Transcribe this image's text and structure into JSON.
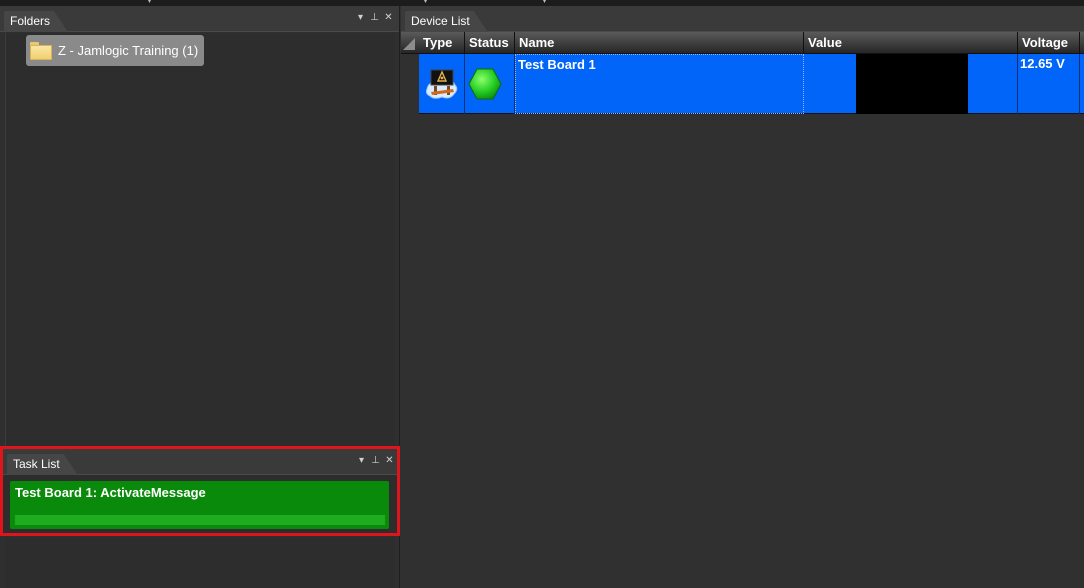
{
  "folders_panel": {
    "title": "Folders",
    "items": [
      {
        "label": "Z - Jamlogic Training (1)"
      }
    ]
  },
  "task_panel": {
    "title": "Task List",
    "tasks": [
      {
        "title": "Test Board 1: ActivateMessage",
        "progress": 1.0
      }
    ]
  },
  "device_panel": {
    "title": "Device List",
    "columns": [
      "Type",
      "Status",
      "Name",
      "Value",
      "Voltage"
    ],
    "rows": [
      {
        "type_icon": "sign-board-icon",
        "status_icon": "green-hexagon-icon",
        "name": "Test Board 1",
        "value": "",
        "voltage": "12.65 V"
      }
    ]
  },
  "pane_controls": {
    "dropdown": "▾",
    "pin": "⊥",
    "close": "✕"
  },
  "colors": {
    "selection": "#0065f8",
    "task_card": "#0a8a0a",
    "highlight_border": "#e0141b",
    "status_ok": "#2ecc2e"
  }
}
